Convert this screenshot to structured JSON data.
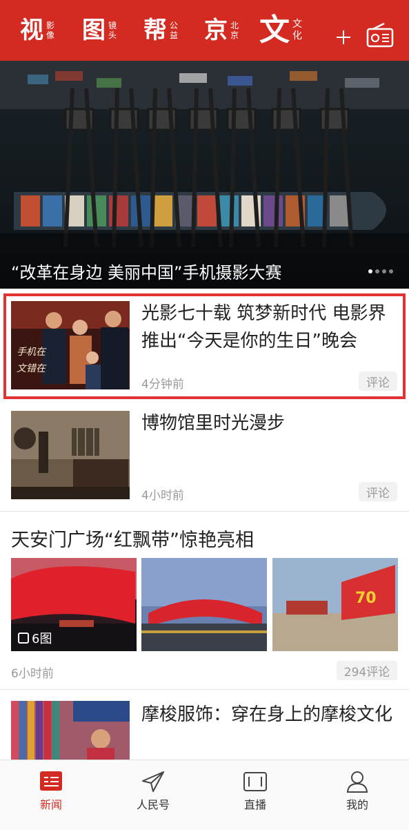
{
  "header": {
    "tabs": [
      {
        "big": "视",
        "small": [
          "影",
          "像"
        ]
      },
      {
        "big": "图",
        "small": [
          "镜",
          "头"
        ]
      },
      {
        "big": "帮",
        "small": [
          "公",
          "益"
        ]
      },
      {
        "big": "京",
        "small": [
          "北",
          "京"
        ]
      },
      {
        "big": "文",
        "small": [
          "文",
          "化"
        ],
        "active": true
      }
    ],
    "add_icon": "plus-icon",
    "radio_icon": "radio-icon",
    "color": "#d32b22"
  },
  "hero": {
    "caption": "“改革在身边 美丽中国”手机摄影大赛",
    "slide_count": 4,
    "active_slide": 1
  },
  "articles": [
    {
      "title": "光影七十载 筑梦新时代 电影界推出“今天是你的生日”晚会",
      "time": "4分钟前",
      "comment_label": "评论",
      "highlighted": true
    },
    {
      "title": "博物馆里时光漫步",
      "time": "4小时前",
      "comment_label": "评论"
    }
  ],
  "gallery": {
    "title": "天安门广场“红飘带”惊艳亮相",
    "image_count_label": "6图",
    "time": "6小时前",
    "comment_label": "294评论"
  },
  "partial_article": {
    "title": "摩梭服饰：穿在身上的摩梭文化"
  },
  "bottom_nav": [
    {
      "label": "新闻",
      "icon": "news-icon",
      "active": true
    },
    {
      "label": "人民号",
      "icon": "paper-plane-icon"
    },
    {
      "label": "直播",
      "icon": "video-camera-icon"
    },
    {
      "label": "我的",
      "icon": "user-icon"
    }
  ],
  "accent_color": "#d32b22",
  "highlight_color": "#e23332"
}
